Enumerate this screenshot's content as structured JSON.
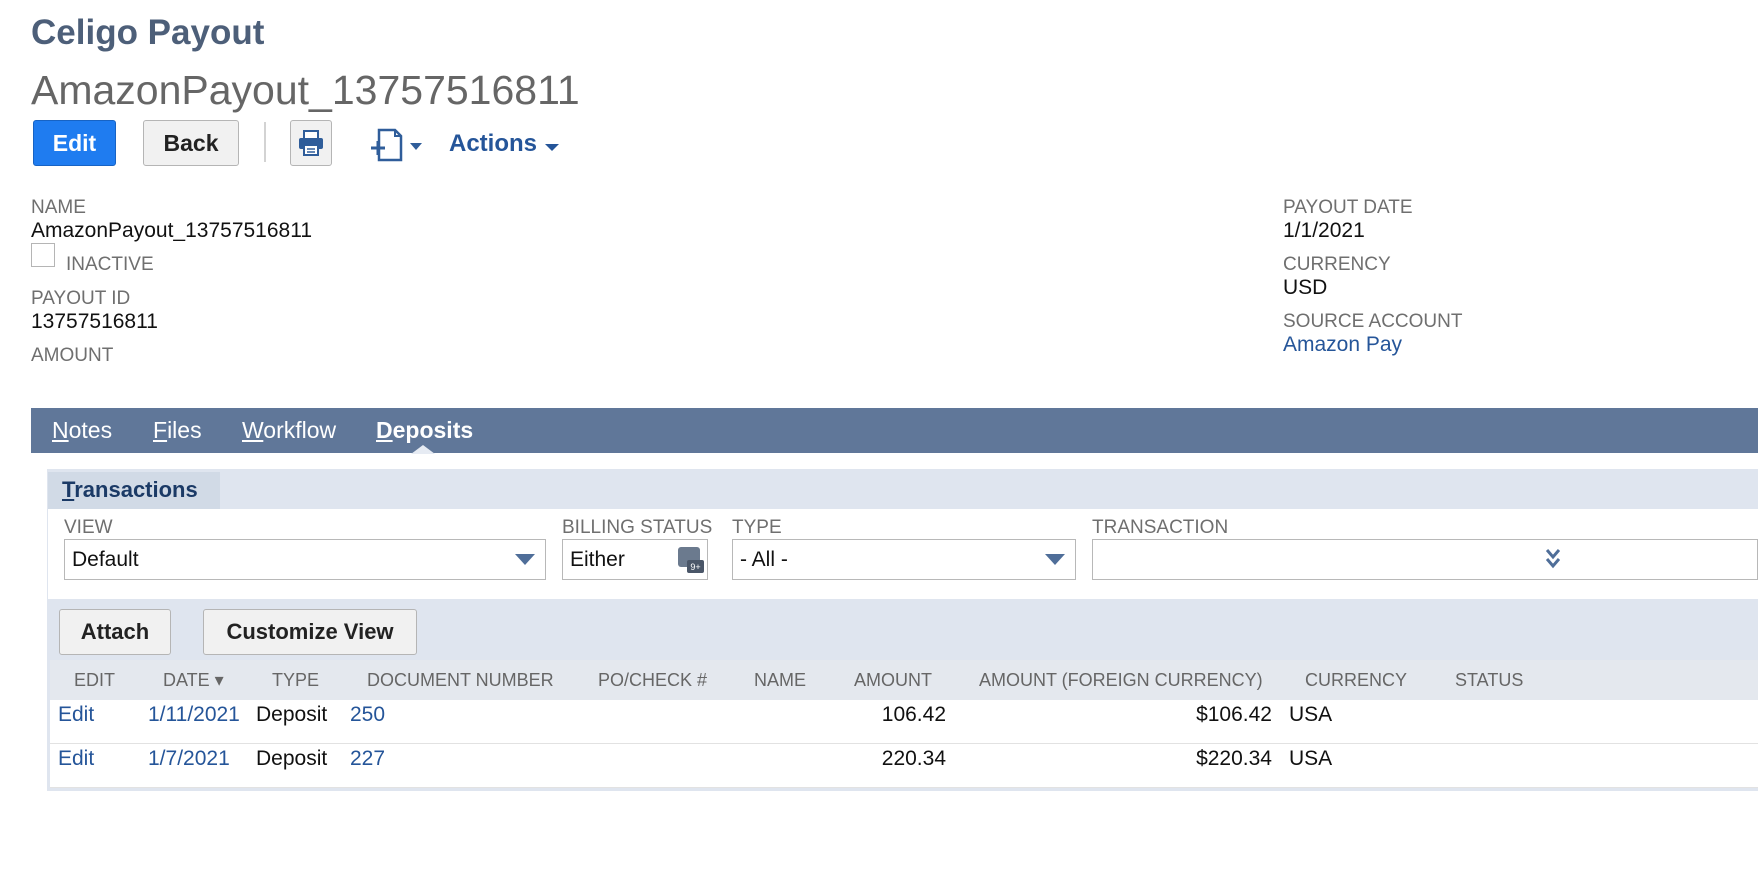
{
  "record": {
    "type_title": "Celigo Payout",
    "name_title": "AmazonPayout_13757516811"
  },
  "toolbar": {
    "edit_label": "Edit",
    "back_label": "Back",
    "actions_label": "Actions"
  },
  "fields": {
    "name_label": "NAME",
    "name_value": "AmazonPayout_13757516811",
    "inactive_label": "INACTIVE",
    "payout_id_label": "PAYOUT ID",
    "payout_id_value": "13757516811",
    "amount_label": "AMOUNT",
    "payout_date_label": "PAYOUT DATE",
    "payout_date_value": "1/1/2021",
    "currency_label": "CURRENCY",
    "currency_value": "USD",
    "source_account_label": "SOURCE ACCOUNT",
    "source_account_value": "Amazon Pay"
  },
  "tabs": [
    {
      "first": "N",
      "rest": "otes"
    },
    {
      "first": "F",
      "rest": "iles"
    },
    {
      "first": "W",
      "rest": "orkflow"
    },
    {
      "first": "D",
      "rest": "eposits"
    }
  ],
  "subtab": {
    "first": "T",
    "rest": "ransactions"
  },
  "filters": {
    "view_label": "VIEW",
    "view_value": "Default",
    "billing_status_label": "BILLING STATUS",
    "billing_status_value": "Either",
    "type_label": "TYPE",
    "type_value": "- All -",
    "transaction_label": "TRANSACTION",
    "transaction_value": ""
  },
  "list_buttons": {
    "attach_label": "Attach",
    "customize_label": "Customize View"
  },
  "table": {
    "columns": [
      "EDIT",
      "DATE ▾",
      "TYPE",
      "DOCUMENT NUMBER",
      "PO/CHECK #",
      "NAME",
      "AMOUNT",
      "AMOUNT (FOREIGN CURRENCY)",
      "CURRENCY",
      "STATUS"
    ],
    "rows": [
      {
        "edit": "Edit",
        "date": "1/11/2021",
        "type": "Deposit",
        "doc": "250",
        "po": "",
        "name": "",
        "amount": "106.42",
        "amount_fc": "$106.42",
        "currency": "USA",
        "status": ""
      },
      {
        "edit": "Edit",
        "date": "1/7/2021",
        "type": "Deposit",
        "doc": "227",
        "po": "",
        "name": "",
        "amount": "220.34",
        "amount_fc": "$220.34",
        "currency": "USA",
        "status": ""
      }
    ]
  },
  "colors": {
    "primary_button": "#1f7cf0",
    "tabbar": "#607799",
    "link": "#255599",
    "title": "#4d5f79"
  }
}
